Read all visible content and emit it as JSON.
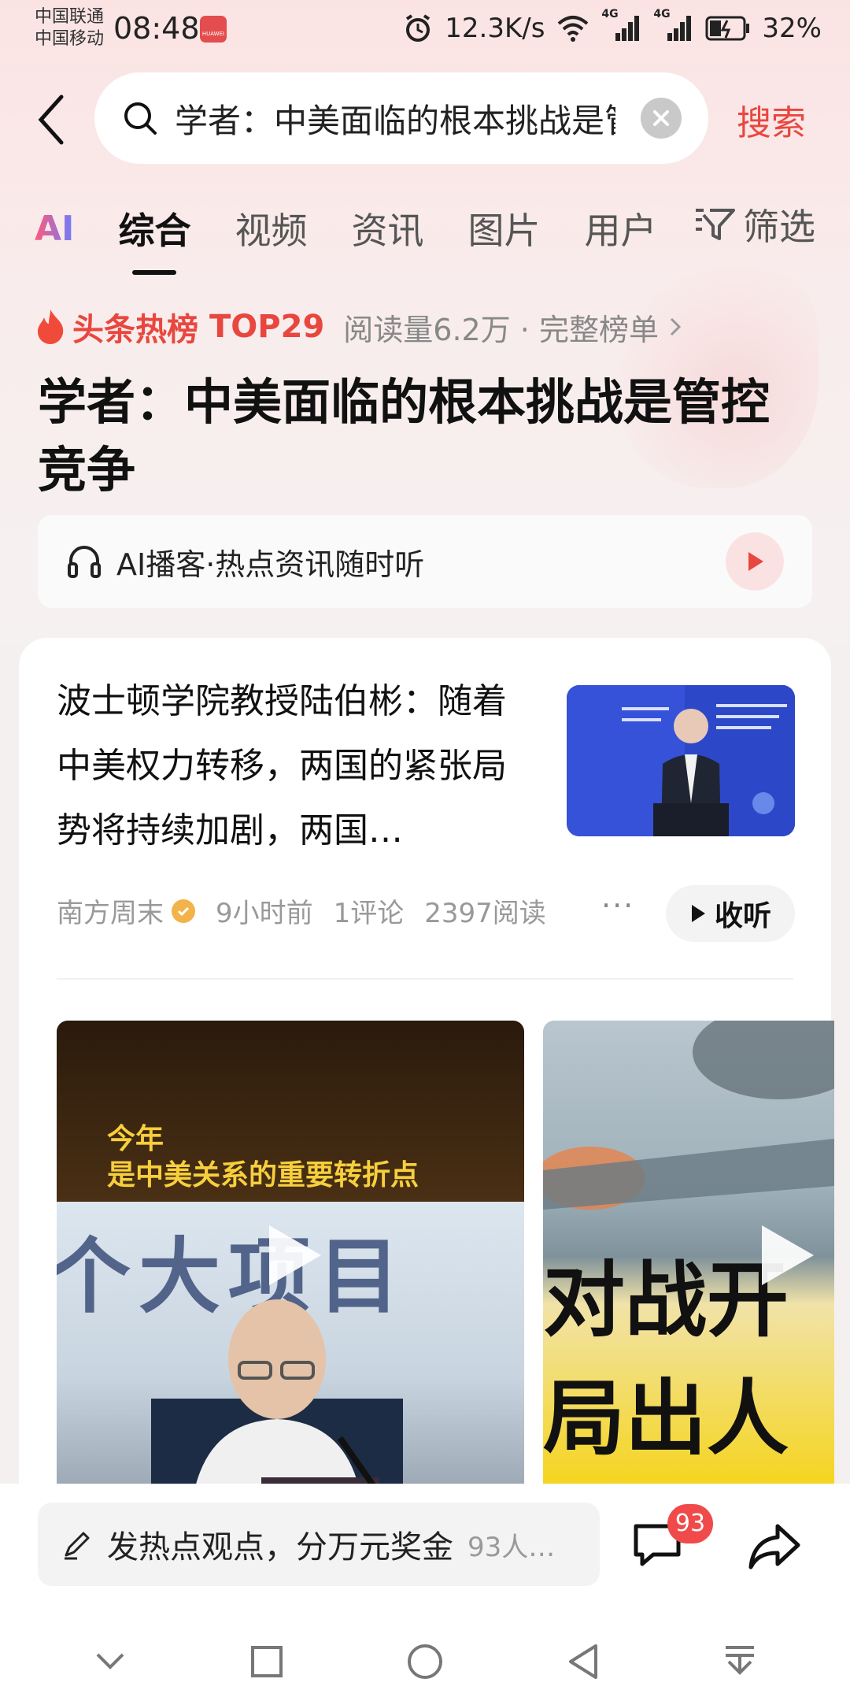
{
  "status_bar": {
    "carrier1": "中国联通",
    "carrier2": "中国移动",
    "time": "08:48",
    "network_speed": "12.3K/s",
    "signal1": "4G",
    "signal2": "4G",
    "battery": "32%"
  },
  "search": {
    "query": "学者：中美面临的根本挑战是管控竞争",
    "action_label": "搜索"
  },
  "tabs": {
    "ai": "AI",
    "items": [
      "综合",
      "视频",
      "资讯",
      "图片",
      "用户"
    ],
    "active": "综合",
    "filter_label": "筛选"
  },
  "hot": {
    "badge": "头条热榜",
    "rank": "TOP29",
    "meta": "阅读量6.2万 · 完整榜单",
    "title": "学者：中美面临的根本挑战是管控竞争"
  },
  "podcast": {
    "label": "AI播客·热点资讯随时听"
  },
  "article": {
    "title": "波士顿学院教授陆伯彬：随着中美权力转移，两国的紧张局势将持续加剧，两国…",
    "source": "南方周末",
    "time": "9小时前",
    "comments": "1评论",
    "reads": "2397阅读",
    "listen_label": "收听"
  },
  "videos": {
    "video1_caption_line1": "今年",
    "video1_caption_line2": "是中美关系的重要转折点",
    "video1_bg_text": "个大项目",
    "video2_text1": "对战开",
    "video2_text2": "局出人"
  },
  "bottom": {
    "comment_prompt": "发热点观点，分万元奖金",
    "comment_people": "93人…",
    "comment_badge": "93"
  },
  "colors": {
    "accent": "#e8473f",
    "badge": "#f04a4a"
  }
}
